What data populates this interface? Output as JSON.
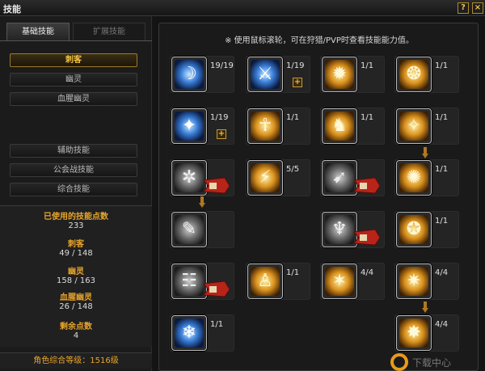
{
  "window": {
    "title": "技能",
    "help_icon": "?",
    "close_icon": "×"
  },
  "tabs": [
    {
      "label": "基础技能",
      "active": true
    },
    {
      "label": "扩展技能",
      "active": false
    }
  ],
  "classes": [
    {
      "label": "刺客",
      "selected": true
    },
    {
      "label": "幽灵",
      "selected": false
    },
    {
      "label": "血腥幽灵",
      "selected": false
    }
  ],
  "categories": [
    {
      "label": "辅助技能"
    },
    {
      "label": "公会战技能"
    },
    {
      "label": "综合技能"
    }
  ],
  "stats": {
    "used_label": "已使用的技能点数",
    "used_value": "233",
    "assassin_label": "刺客",
    "assassin_value": "49 / 148",
    "ghost_label": "幽灵",
    "ghost_value": "158 / 163",
    "blood_label": "血腥幽灵",
    "blood_value": "26 / 148",
    "remaining_label": "剩余点数",
    "remaining_value": "4",
    "level_text": "角色综合等级：1516级"
  },
  "notice": "※ 使用鼠标滚轮，可在狩猎/PVP时查看技能能力值。",
  "skills": [
    {
      "level": "19/19",
      "style": "blue",
      "glyph": "☽"
    },
    {
      "level": "1/19",
      "style": "blue",
      "glyph": "⚔",
      "plus": "+"
    },
    {
      "level": "1/1",
      "style": "gold",
      "glyph": "✹"
    },
    {
      "level": "1/1",
      "style": "gold",
      "glyph": "❂"
    },
    {
      "level": "1/19",
      "style": "blue",
      "glyph": "✦",
      "plus": "+"
    },
    {
      "level": "1/1",
      "style": "gold",
      "glyph": "☥"
    },
    {
      "level": "1/1",
      "style": "gold",
      "glyph": "♞"
    },
    {
      "level": "1/1",
      "style": "gold",
      "glyph": "✧"
    },
    {
      "level": "",
      "style": "grey",
      "glyph": "✲",
      "locked": true
    },
    {
      "level": "5/5",
      "style": "gold",
      "glyph": "⚡"
    },
    {
      "level": "",
      "style": "grey",
      "glyph": "➹",
      "locked": true
    },
    {
      "level": "1/1",
      "style": "gold",
      "glyph": "✺"
    },
    {
      "level": "",
      "style": "grey",
      "glyph": "✎",
      "locked": false
    },
    {
      "level": "",
      "style": "grey",
      "glyph": "♆",
      "locked": true
    },
    {
      "level": "1/1",
      "style": "gold",
      "glyph": "✪"
    },
    {
      "level": "",
      "style": "grey",
      "glyph": "☷",
      "locked": true
    },
    {
      "level": "1/1",
      "style": "gold",
      "glyph": "♙"
    },
    {
      "level": "4/4",
      "style": "gold",
      "glyph": "✶"
    },
    {
      "level": "4/4",
      "style": "gold",
      "glyph": "✷"
    },
    {
      "level": "1/1",
      "style": "blue",
      "glyph": "❄"
    },
    {
      "level": "4/4",
      "style": "gold",
      "glyph": "✸"
    }
  ],
  "watermark": "下载中心"
}
